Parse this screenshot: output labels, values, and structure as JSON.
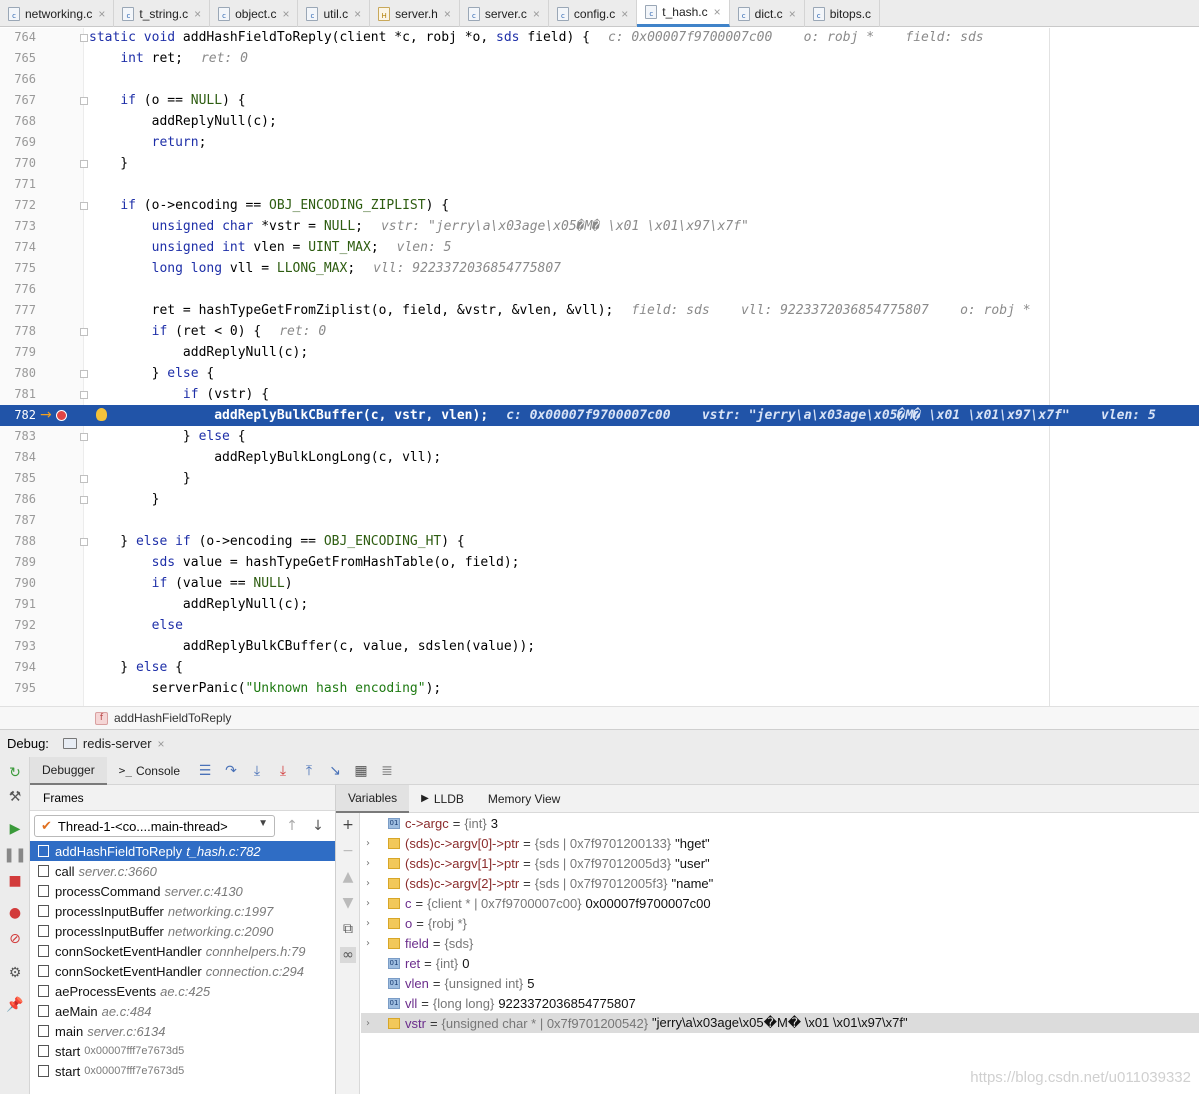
{
  "tabs": [
    {
      "label": "networking.c",
      "icon": "c-file-icon",
      "close": "×",
      "active": false
    },
    {
      "label": "t_string.c",
      "icon": "c-file-icon",
      "close": "×",
      "active": false
    },
    {
      "label": "object.c",
      "icon": "c-file-icon",
      "close": "×",
      "active": false
    },
    {
      "label": "util.c",
      "icon": "c-file-icon",
      "close": "×",
      "active": false
    },
    {
      "label": "server.h",
      "icon": "h-file-icon",
      "close": "×",
      "active": false
    },
    {
      "label": "server.c",
      "icon": "c-file-icon",
      "close": "×",
      "active": false
    },
    {
      "label": "config.c",
      "icon": "c-file-icon",
      "close": "×",
      "active": false
    },
    {
      "label": "t_hash.c",
      "icon": "c-file-icon",
      "close": "×",
      "active": true
    },
    {
      "label": "dict.c",
      "icon": "c-file-icon",
      "close": "×",
      "active": false
    },
    {
      "label": "bitops.c",
      "icon": "c-file-icon",
      "close": "",
      "active": false
    }
  ],
  "editor": {
    "lines": [
      {
        "num": "764",
        "text": "static void addHashFieldToReply(client *c, robj *o, sds field) {",
        "hint": "c: 0x00007f9700007c00    o: robj *    field: sds"
      },
      {
        "num": "765",
        "text": "    int ret;",
        "hint": "ret: 0"
      },
      {
        "num": "766",
        "text": "",
        "hint": ""
      },
      {
        "num": "767",
        "text": "    if (o == NULL) {",
        "hint": ""
      },
      {
        "num": "768",
        "text": "        addReplyNull(c);",
        "hint": ""
      },
      {
        "num": "769",
        "text": "        return;",
        "hint": ""
      },
      {
        "num": "770",
        "text": "    }",
        "hint": ""
      },
      {
        "num": "771",
        "text": "",
        "hint": ""
      },
      {
        "num": "772",
        "text": "    if (o->encoding == OBJ_ENCODING_ZIPLIST) {",
        "hint": ""
      },
      {
        "num": "773",
        "text": "        unsigned char *vstr = NULL;",
        "hint": "vstr: \"jerry\\a\\x03age\\x05�M� \\x01 \\x01\\x97\\x7f\""
      },
      {
        "num": "774",
        "text": "        unsigned int vlen = UINT_MAX;",
        "hint": "vlen: 5"
      },
      {
        "num": "775",
        "text": "        long long vll = LLONG_MAX;",
        "hint": "vll: 9223372036854775807"
      },
      {
        "num": "776",
        "text": "",
        "hint": ""
      },
      {
        "num": "777",
        "text": "        ret = hashTypeGetFromZiplist(o, field, &vstr, &vlen, &vll);",
        "hint": "field: sds    vll: 9223372036854775807    o: robj *"
      },
      {
        "num": "778",
        "text": "        if (ret < 0) {",
        "hint": "ret: 0"
      },
      {
        "num": "779",
        "text": "            addReplyNull(c);",
        "hint": ""
      },
      {
        "num": "780",
        "text": "        } else {",
        "hint": ""
      },
      {
        "num": "781",
        "text": "            if (vstr) {",
        "hint": ""
      },
      {
        "num": "782",
        "text": "                addReplyBulkCBuffer(c, vstr, vlen);",
        "hint": "c: 0x00007f9700007c00    vstr: \"jerry\\a\\x03age\\x05�M� \\x01 \\x01\\x97\\x7f\"    vlen: 5"
      },
      {
        "num": "783",
        "text": "            } else {",
        "hint": ""
      },
      {
        "num": "784",
        "text": "                addReplyBulkLongLong(c, vll);",
        "hint": ""
      },
      {
        "num": "785",
        "text": "            }",
        "hint": ""
      },
      {
        "num": "786",
        "text": "        }",
        "hint": ""
      },
      {
        "num": "787",
        "text": "",
        "hint": ""
      },
      {
        "num": "788",
        "text": "    } else if (o->encoding == OBJ_ENCODING_HT) {",
        "hint": ""
      },
      {
        "num": "789",
        "text": "        sds value = hashTypeGetFromHashTable(o, field);",
        "hint": ""
      },
      {
        "num": "790",
        "text": "        if (value == NULL)",
        "hint": ""
      },
      {
        "num": "791",
        "text": "            addReplyNull(c);",
        "hint": ""
      },
      {
        "num": "792",
        "text": "        else",
        "hint": ""
      },
      {
        "num": "793",
        "text": "            addReplyBulkCBuffer(c, value, sdslen(value));",
        "hint": ""
      },
      {
        "num": "794",
        "text": "    } else {",
        "hint": ""
      },
      {
        "num": "795",
        "text": "        serverPanic(\"Unknown hash encoding\");",
        "hint": ""
      }
    ],
    "current_line": "782"
  },
  "breadcrumb": {
    "badge": "f",
    "label": "addHashFieldToReply"
  },
  "debug": {
    "label": "Debug:",
    "session": "redis-server",
    "session_close": "×",
    "tabs": {
      "debugger": "Debugger",
      "console": "Console"
    },
    "frames_title": "Frames",
    "thread": "Thread-1-<co....main-thread>",
    "frames": [
      {
        "name": "addHashFieldToReply",
        "loc": "t_hash.c:782",
        "addr": "",
        "selected": true
      },
      {
        "name": "call",
        "loc": "server.c:3660",
        "addr": "",
        "selected": false
      },
      {
        "name": "processCommand",
        "loc": "server.c:4130",
        "addr": "",
        "selected": false
      },
      {
        "name": "processInputBuffer",
        "loc": "networking.c:1997",
        "addr": "",
        "selected": false
      },
      {
        "name": "processInputBuffer",
        "loc": "networking.c:2090",
        "addr": "",
        "selected": false
      },
      {
        "name": "connSocketEventHandler",
        "loc": "connhelpers.h:79",
        "addr": "",
        "selected": false
      },
      {
        "name": "connSocketEventHandler",
        "loc": "connection.c:294",
        "addr": "",
        "selected": false
      },
      {
        "name": "aeProcessEvents",
        "loc": "ae.c:425",
        "addr": "",
        "selected": false
      },
      {
        "name": "aeMain",
        "loc": "ae.c:484",
        "addr": "",
        "selected": false
      },
      {
        "name": "main",
        "loc": "server.c:6134",
        "addr": "",
        "selected": false
      },
      {
        "name": "start",
        "loc": "",
        "addr": "0x00007fff7e7673d5",
        "selected": false
      },
      {
        "name": "start",
        "loc": "",
        "addr": "0x00007fff7e7673d5",
        "selected": false
      }
    ],
    "var_tabs": {
      "variables": "Variables",
      "lldb": "LLDB",
      "memory": "Memory View"
    },
    "variables": [
      {
        "expand": "",
        "icon": "prim",
        "name": "c->argc",
        "watch": true,
        "type": "{int}",
        "value": "3",
        "highlight": false
      },
      {
        "expand": "›",
        "icon": "obj",
        "name": "(sds)c->argv[0]->ptr",
        "watch": true,
        "type": "{sds | 0x7f9701200133}",
        "value": "\"hget\"",
        "highlight": false
      },
      {
        "expand": "›",
        "icon": "obj",
        "name": "(sds)c->argv[1]->ptr",
        "watch": true,
        "type": "{sds | 0x7f97012005d3}",
        "value": "\"user\"",
        "highlight": false
      },
      {
        "expand": "›",
        "icon": "obj",
        "name": "(sds)c->argv[2]->ptr",
        "watch": true,
        "type": "{sds | 0x7f97012005f3}",
        "value": "\"name\"",
        "highlight": false
      },
      {
        "expand": "›",
        "icon": "obj",
        "name": "c",
        "watch": false,
        "type": "{client * | 0x7f9700007c00}",
        "value": "0x00007f9700007c00",
        "highlight": false
      },
      {
        "expand": "›",
        "icon": "obj",
        "name": "o",
        "watch": false,
        "type": "{robj *}",
        "value": "",
        "highlight": false
      },
      {
        "expand": "›",
        "icon": "obj",
        "name": "field",
        "watch": false,
        "type": "{sds}",
        "value": "",
        "highlight": false
      },
      {
        "expand": "",
        "icon": "prim",
        "name": "ret",
        "watch": false,
        "type": "{int}",
        "value": "0",
        "highlight": false
      },
      {
        "expand": "",
        "icon": "prim",
        "name": "vlen",
        "watch": false,
        "type": "{unsigned int}",
        "value": "5",
        "highlight": false
      },
      {
        "expand": "",
        "icon": "prim",
        "name": "vll",
        "watch": false,
        "type": "{long long}",
        "value": "9223372036854775807",
        "highlight": false
      },
      {
        "expand": "›",
        "icon": "obj",
        "name": "vstr",
        "watch": false,
        "type": "{unsigned char * | 0x7f9701200542}",
        "value": "\"jerry\\a\\x03age\\x05�M� \\x01 \\x01\\x97\\x7f\"",
        "highlight": true
      }
    ]
  },
  "watermark": "https://blog.csdn.net/u011039332",
  "colors": {
    "selection": "#2154a8",
    "frame_selected": "#2f6dc5",
    "keyword": "#1e2fa8",
    "string": "#1e7a12"
  }
}
